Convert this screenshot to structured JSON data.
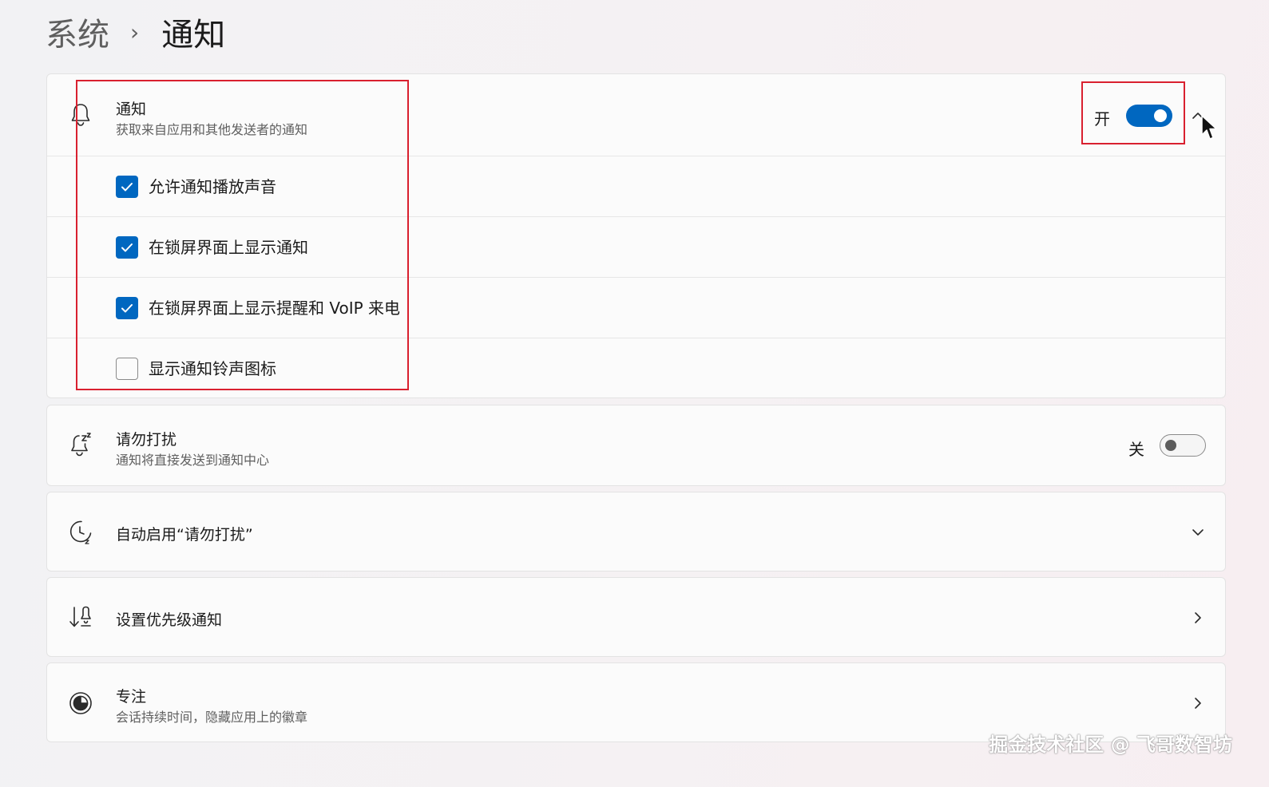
{
  "breadcrumb": {
    "parent": "系统",
    "separator": "›",
    "current": "通知"
  },
  "notifications": {
    "title": "通知",
    "subtitle": "获取来自应用和其他发送者的通知",
    "toggle_label": "开",
    "toggle_state": true,
    "options": [
      {
        "label": "允许通知播放声音",
        "checked": true
      },
      {
        "label": "在锁屏界面上显示通知",
        "checked": true
      },
      {
        "label": "在锁屏界面上显示提醒和 VoIP 来电",
        "checked": true
      },
      {
        "label": "显示通知铃声图标",
        "checked": false
      }
    ]
  },
  "do_not_disturb": {
    "title": "请勿打扰",
    "subtitle": "通知将直接发送到通知中心",
    "toggle_label": "关",
    "toggle_state": false
  },
  "auto_dnd": {
    "title": "自动启用“请勿打扰”"
  },
  "priority": {
    "title": "设置优先级通知"
  },
  "focus": {
    "title": "专注",
    "subtitle": "会话持续时间，隐藏应用上的徽章"
  },
  "watermark": "掘金技术社区 @ 飞哥数智坊",
  "colors": {
    "accent": "#0067c0",
    "highlight": "#d9202f"
  },
  "icons": {
    "notifications": "bell-icon",
    "do_not_disturb": "bell-snooze-icon",
    "auto_dnd": "clock-icon",
    "priority": "priority-sort-icon",
    "focus": "focus-icon"
  }
}
